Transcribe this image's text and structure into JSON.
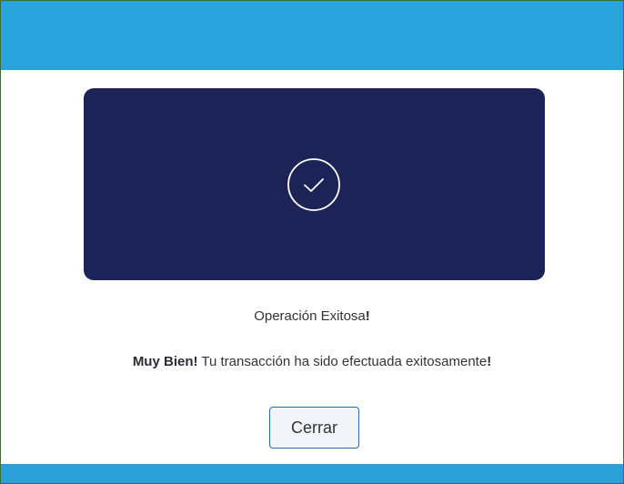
{
  "modal": {
    "status_title": {
      "text": "Operación Exitosa",
      "mark": "!"
    },
    "message": {
      "lead": "Muy Bien!",
      "body": " Tu transacción ha sido efectuada exitosamente",
      "mark": "!"
    },
    "close_label": "Cerrar",
    "hero_icon": "check-circle-icon"
  },
  "colors": {
    "header_bar": "#2aa2dc",
    "hero_panel": "#1c2457",
    "button_border": "#2b6aa8"
  }
}
